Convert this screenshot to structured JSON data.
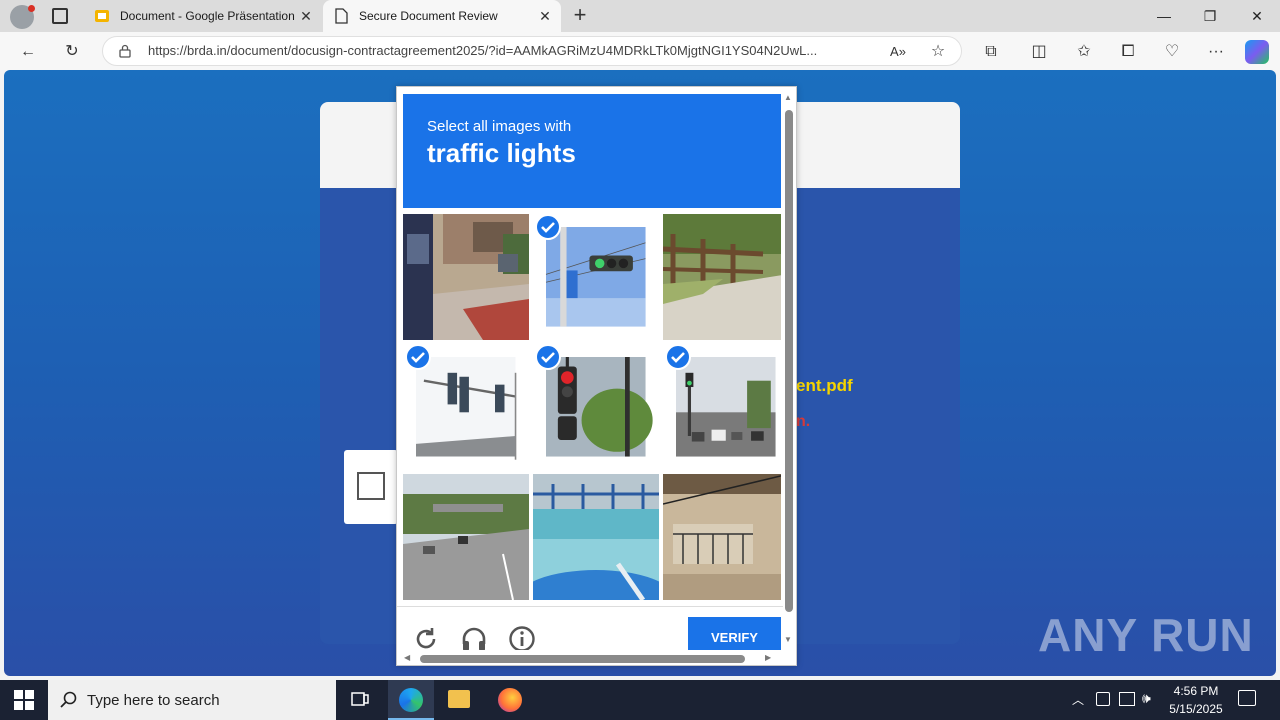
{
  "browser": {
    "tabs": [
      {
        "title": "Document - Google Präsentation"
      },
      {
        "title": "Secure Document Review"
      }
    ],
    "url": "https://brda.in/document/docusign-contractagreement2025/?id=AAMkAGRiMzU4MDRkLTk0MjgtNGI1YS04N2UwL..."
  },
  "page": {
    "pdf_fragment": "ent.pdf",
    "red_fragment": "n."
  },
  "captcha": {
    "prompt": "Select all images with",
    "object": "traffic lights",
    "verify_label": "VERIFY",
    "tiles": [
      {
        "name": "street-bus",
        "selected": false
      },
      {
        "name": "traffic-light-pole",
        "selected": true
      },
      {
        "name": "fence-path",
        "selected": false
      },
      {
        "name": "traffic-lights-overhead",
        "selected": true
      },
      {
        "name": "red-traffic-light",
        "selected": true
      },
      {
        "name": "street-traffic-light",
        "selected": true
      },
      {
        "name": "highway",
        "selected": false
      },
      {
        "name": "water-pool",
        "selected": false
      },
      {
        "name": "building-balcony",
        "selected": false
      }
    ]
  },
  "watermark": "ANY RUN",
  "taskbar": {
    "search_placeholder": "Type here to search",
    "time": "4:56 PM",
    "date": "5/15/2025"
  },
  "colors": {
    "accent": "#1a73e8",
    "page_bg": "#1e5fb3",
    "taskbar": "#1b2233"
  }
}
